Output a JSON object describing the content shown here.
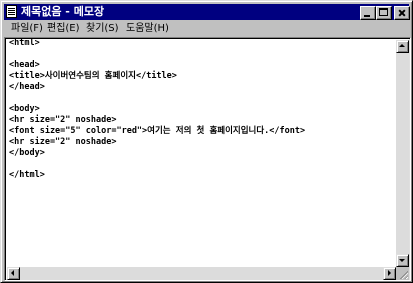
{
  "window": {
    "title": "제목없음 - 메모장"
  },
  "menu": {
    "items": [
      {
        "label": "파일(F)"
      },
      {
        "label": "편집(E)"
      },
      {
        "label": "찾기(S)"
      },
      {
        "label": "도움말(H)"
      }
    ]
  },
  "editor": {
    "lines": [
      "<html>",
      "",
      "<head>",
      "<title>사이버연수팀의 홈페이지</title>",
      "</head>",
      "",
      "<body>",
      "<hr size=\"2\" noshade>",
      "<font size=\"5\" color=\"red\">여기는 저의 첫 홈페이지입니다.</font>",
      "<hr size=\"2\" noshade>",
      "</body>",
      "",
      "</html>"
    ]
  },
  "icons": {
    "app": "notepad-icon",
    "minimize": "minimize-icon",
    "maximize": "maximize-icon",
    "close": "close-icon"
  },
  "colors": {
    "titlebar": "#000080",
    "face": "#c0c0c0",
    "editor_bg": "#ffffff"
  }
}
